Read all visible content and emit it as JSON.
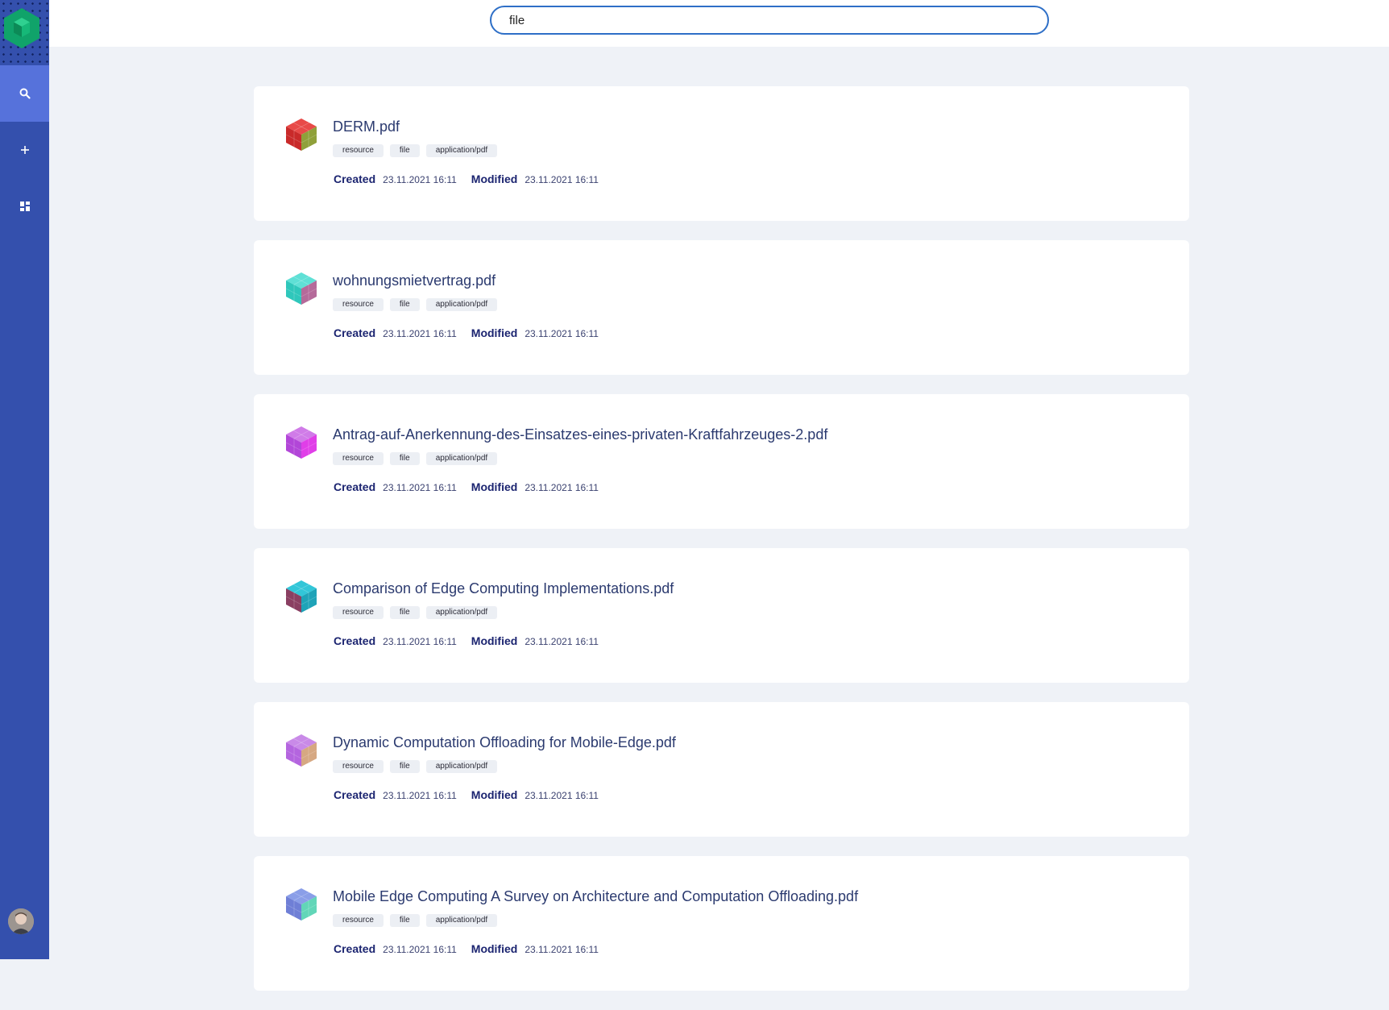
{
  "search": {
    "value": "file",
    "placeholder": ""
  },
  "sidebar": {
    "logo_icon": "hexagon-logo-icon",
    "items": [
      {
        "icon": "search-icon",
        "active": true
      },
      {
        "icon": "plus-icon",
        "active": false
      },
      {
        "icon": "dashboard-icon",
        "active": false
      }
    ],
    "colors": {
      "background": "#3450ad",
      "active": "#5672db",
      "logo": "#10a36a"
    }
  },
  "results": [
    {
      "title": "DERM.pdf",
      "tags": [
        "resource",
        "file",
        "application/pdf"
      ],
      "created_label": "Created",
      "created": "23.11.2021 16:11",
      "modified_label": "Modified",
      "modified": "23.11.2021 16:11",
      "icon": "cube-icon",
      "colors": [
        "#e84a48",
        "#c92a2a",
        "#8fa03a"
      ]
    },
    {
      "title": "wohnungsmietvertrag.pdf",
      "tags": [
        "resource",
        "file",
        "application/pdf"
      ],
      "created_label": "Created",
      "created": "23.11.2021 16:11",
      "modified_label": "Modified",
      "modified": "23.11.2021 16:11",
      "icon": "cube-icon",
      "colors": [
        "#5fe0d6",
        "#2fc7bb",
        "#b56a9a"
      ]
    },
    {
      "title": "Antrag-auf-Anerkennung-des-Einsatzes-eines-privaten-Kraftfahrzeuges-2.pdf",
      "tags": [
        "resource",
        "file",
        "application/pdf"
      ],
      "created_label": "Created",
      "created": "23.11.2021 16:11",
      "modified_label": "Modified",
      "modified": "23.11.2021 16:11",
      "icon": "cube-icon",
      "colors": [
        "#d07be8",
        "#b246d8",
        "#e03ee8"
      ]
    },
    {
      "title": "Comparison of Edge Computing Implementations.pdf",
      "tags": [
        "resource",
        "file",
        "application/pdf"
      ],
      "created_label": "Created",
      "created": "23.11.2021 16:11",
      "modified_label": "Modified",
      "modified": "23.11.2021 16:11",
      "icon": "cube-icon",
      "colors": [
        "#32c6d8",
        "#8a3f62",
        "#1fa3b8"
      ]
    },
    {
      "title": "Dynamic Computation Offloading for Mobile-Edge.pdf",
      "tags": [
        "resource",
        "file",
        "application/pdf"
      ],
      "created_label": "Created",
      "created": "23.11.2021 16:11",
      "modified_label": "Modified",
      "modified": "23.11.2021 16:11",
      "icon": "cube-icon",
      "colors": [
        "#c98ae8",
        "#b465df",
        "#d6a882"
      ]
    },
    {
      "title": "Mobile Edge Computing A Survey on Architecture and Computation Offloading.pdf",
      "tags": [
        "resource",
        "file",
        "application/pdf"
      ],
      "created_label": "Created",
      "created": "23.11.2021 16:11",
      "modified_label": "Modified",
      "modified": "23.11.2021 16:11",
      "icon": "cube-icon",
      "colors": [
        "#8a9ee8",
        "#6f7fd6",
        "#62d6b8"
      ]
    }
  ]
}
